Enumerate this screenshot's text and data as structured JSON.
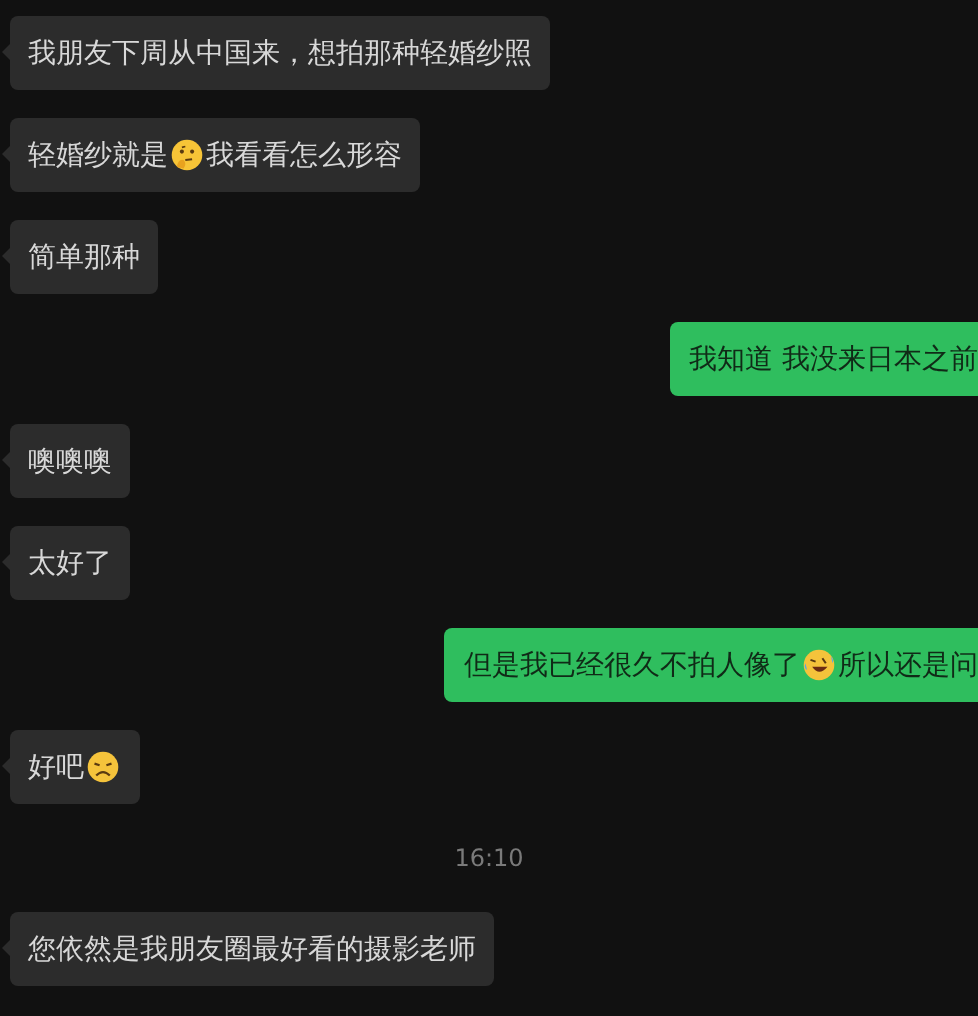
{
  "messages": [
    {
      "kind": "message",
      "outgoing": false,
      "parts": [
        {
          "kind": "text",
          "text": "我朋友下周从中国来，想拍那种轻婚纱照"
        }
      ]
    },
    {
      "kind": "message",
      "outgoing": false,
      "parts": [
        {
          "kind": "text",
          "text": "轻婚纱就是"
        },
        {
          "kind": "thinking"
        },
        {
          "kind": "text",
          "text": "我看看怎么形容"
        }
      ]
    },
    {
      "kind": "message",
      "outgoing": false,
      "parts": [
        {
          "kind": "text",
          "text": "简单那种"
        }
      ]
    },
    {
      "kind": "message",
      "outgoing": true,
      "parts": [
        {
          "kind": "text",
          "text": "我知道 我没来日本之前"
        }
      ]
    },
    {
      "kind": "message",
      "outgoing": false,
      "parts": [
        {
          "kind": "text",
          "text": "噢噢噢"
        }
      ]
    },
    {
      "kind": "message",
      "outgoing": false,
      "parts": [
        {
          "kind": "text",
          "text": "太好了"
        }
      ]
    },
    {
      "kind": "message",
      "outgoing": true,
      "parts": [
        {
          "kind": "text",
          "text": "但是我已经很久不拍人像了"
        },
        {
          "kind": "laughing"
        },
        {
          "kind": "text",
          "text": "所以还是问"
        }
      ]
    },
    {
      "kind": "message",
      "outgoing": false,
      "parts": [
        {
          "kind": "text",
          "text": "好吧"
        },
        {
          "kind": "grumpy"
        }
      ]
    },
    {
      "kind": "time",
      "text": "16:10"
    },
    {
      "kind": "message",
      "outgoing": false,
      "parts": [
        {
          "kind": "text",
          "text": "您依然是我朋友圈最好看的摄影老师"
        }
      ]
    }
  ]
}
